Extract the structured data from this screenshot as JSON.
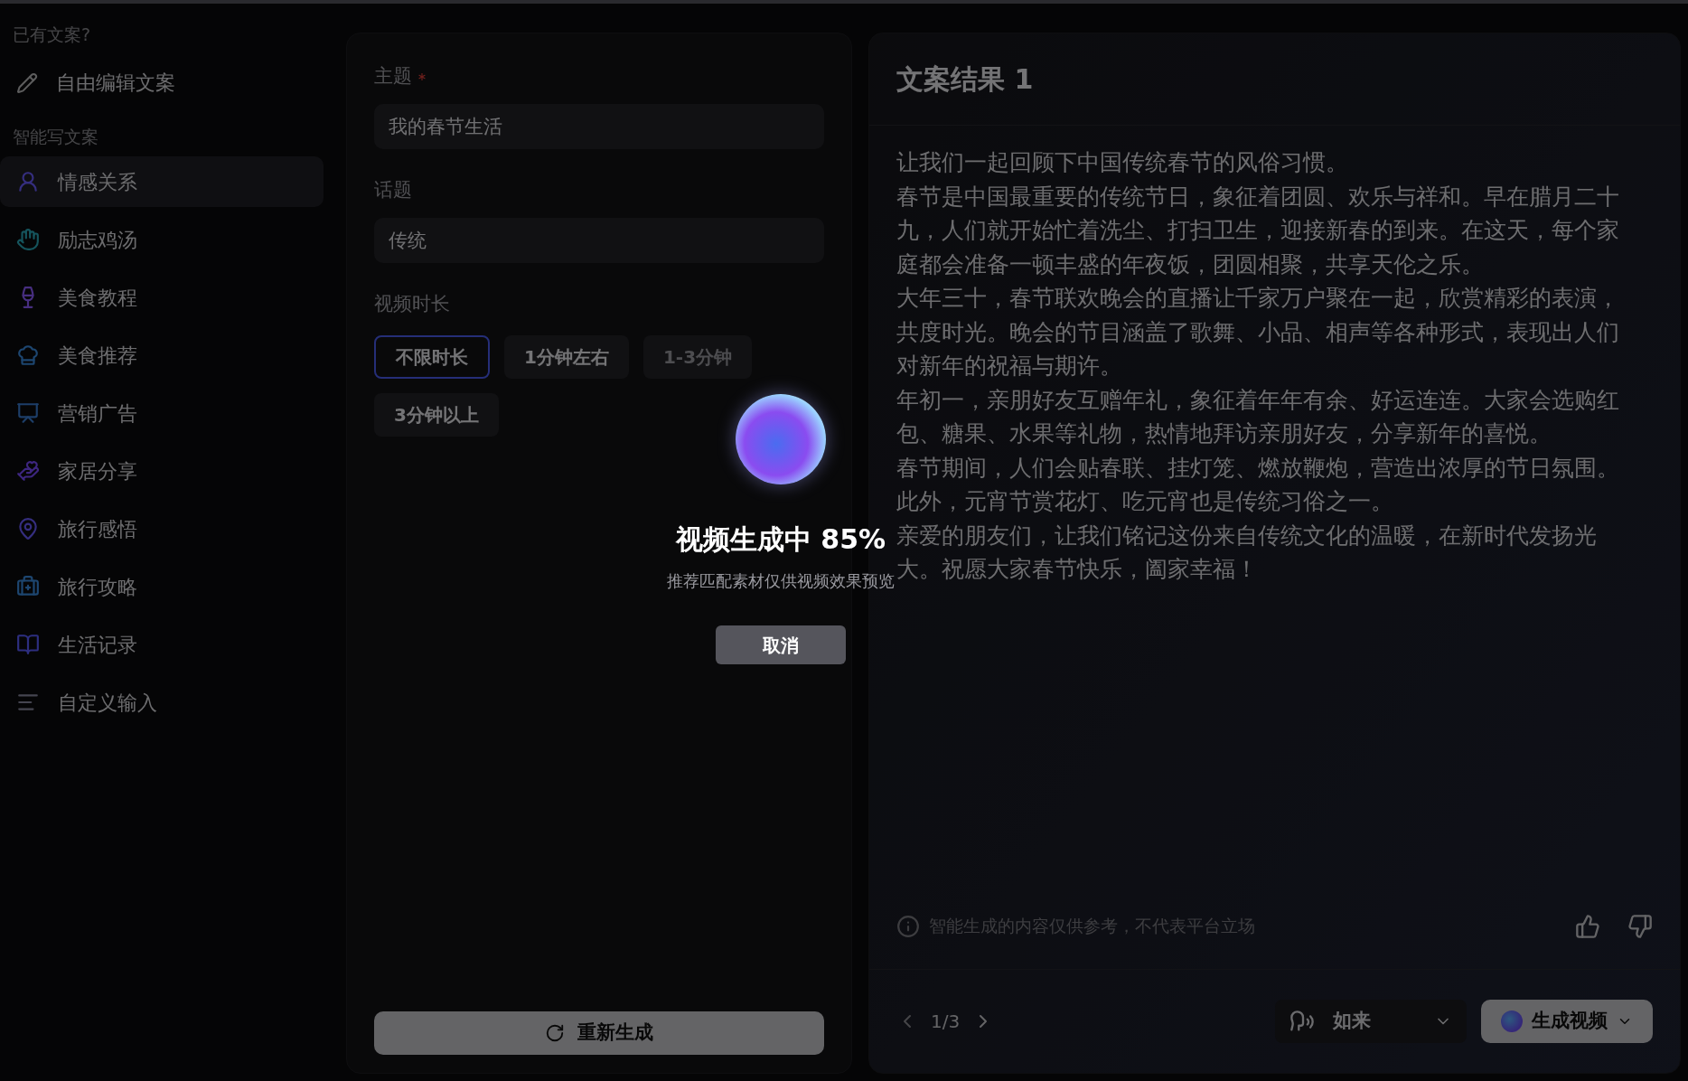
{
  "sidebar": {
    "existing_heading": "已有文案?",
    "free_edit": {
      "label": "自由编辑文案"
    },
    "smart_heading": "智能写文案",
    "items": [
      {
        "label": "情感关系",
        "selected": true
      },
      {
        "label": "励志鸡汤",
        "selected": false
      },
      {
        "label": "美食教程",
        "selected": false
      },
      {
        "label": "美食推荐",
        "selected": false
      },
      {
        "label": "营销广告",
        "selected": false
      },
      {
        "label": "家居分享",
        "selected": false
      },
      {
        "label": "旅行感悟",
        "selected": false
      },
      {
        "label": "旅行攻略",
        "selected": false
      },
      {
        "label": "生活记录",
        "selected": false
      },
      {
        "label": "自定义输入",
        "selected": false
      }
    ]
  },
  "form": {
    "fields": [
      {
        "label": "主题",
        "required": true,
        "value": "我的春节生活"
      },
      {
        "label": "话题",
        "required": false,
        "value": "传统"
      }
    ],
    "duration": {
      "label": "视频时长",
      "options": [
        {
          "label": "不限时长",
          "selected": true,
          "disabled": false
        },
        {
          "label": "1分钟左右",
          "selected": false,
          "disabled": false
        },
        {
          "label": "1-3分钟",
          "selected": false,
          "disabled": true
        },
        {
          "label": "3分钟以上",
          "selected": false,
          "disabled": false
        }
      ]
    },
    "regenerate_button": "重新生成"
  },
  "result": {
    "title": "文案结果 1",
    "paragraphs": [
      "让我们一起回顾下中国传统春节的风俗习惯。",
      "春节是中国最重要的传统节日，象征着团圆、欢乐与祥和。早在腊月二十九，人们就开始忙着洗尘、打扫卫生，迎接新春的到来。在这天，每个家庭都会准备一顿丰盛的年夜饭，团圆相聚，共享天伦之乐。",
      "大年三十，春节联欢晚会的直播让千家万户聚在一起，欣赏精彩的表演，共度时光。晚会的节目涵盖了歌舞、小品、相声等各种形式，表现出人们对新年的祝福与期许。",
      "年初一，亲朋好友互赠年礼，象征着年年有余、好运连连。大家会选购红包、糖果、水果等礼物，热情地拜访亲朋好友，分享新年的喜悦。",
      "春节期间，人们会贴春联、挂灯笼、燃放鞭炮，营造出浓厚的节日氛围。此外，元宵节赏花灯、吃元宵也是传统习俗之一。",
      "亲爱的朋友们，让我们铭记这份来自传统文化的温暖，在新时代发扬光大。祝愿大家春节快乐，阖家幸福！"
    ],
    "disclaimer": "智能生成的内容仅供参考，不代表平台立场",
    "pager": "1/3",
    "voice": "如来",
    "generate_button": "生成视频"
  },
  "overlay": {
    "title": "视频生成中 85%",
    "subtitle": "推荐匹配素材仅供视频效果预览",
    "cancel_button": "取消"
  }
}
